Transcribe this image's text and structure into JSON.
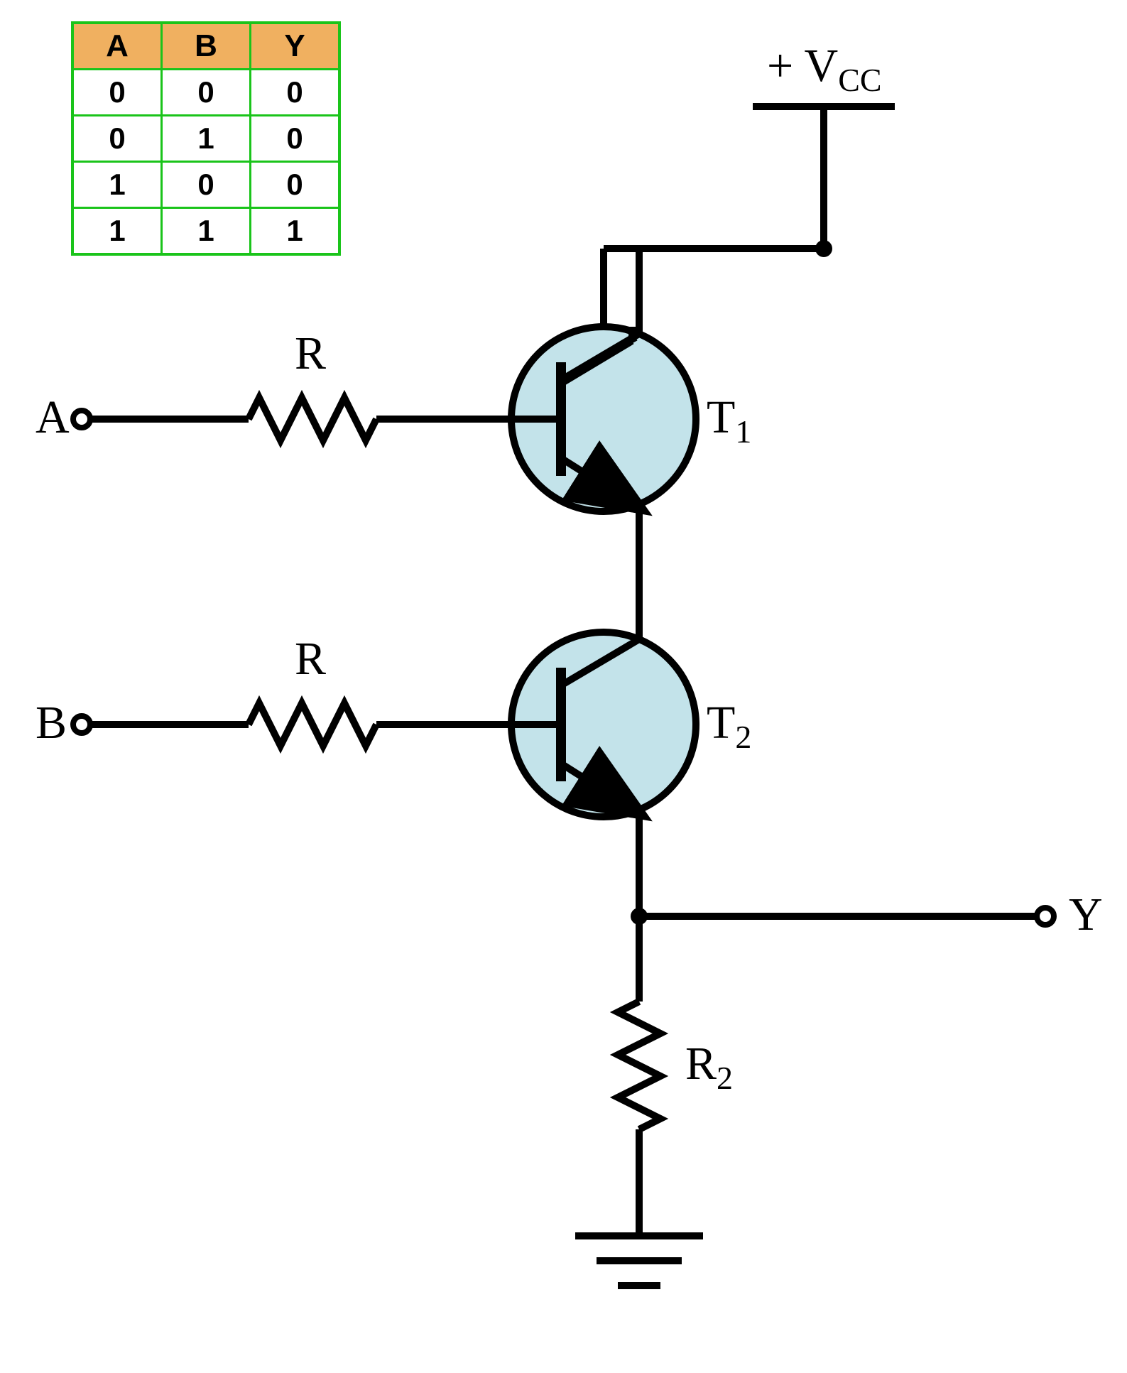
{
  "truth_table": {
    "headers": [
      "A",
      "B",
      "Y"
    ],
    "rows": [
      [
        "0",
        "0",
        "0"
      ],
      [
        "0",
        "1",
        "0"
      ],
      [
        "1",
        "0",
        "0"
      ],
      [
        "1",
        "1",
        "1"
      ]
    ]
  },
  "labels": {
    "vcc_plus": "+ V",
    "vcc_sub": "CC",
    "input_a": "A",
    "input_b": "B",
    "output_y": "Y",
    "resistor_a": "R",
    "resistor_b": "R",
    "resistor_2_base": "R",
    "resistor_2_sub": "2",
    "transistor_1_base": "T",
    "transistor_1_sub": "1",
    "transistor_2_base": "T",
    "transistor_2_sub": "2"
  },
  "circuit": {
    "gate_type": "AND",
    "components": [
      "NPN transistor T1",
      "NPN transistor T2",
      "base resistor R (A)",
      "base resistor R (B)",
      "emitter resistor R2",
      "supply +Vcc",
      "ground"
    ],
    "inputs": [
      "A",
      "B"
    ],
    "output": "Y"
  }
}
